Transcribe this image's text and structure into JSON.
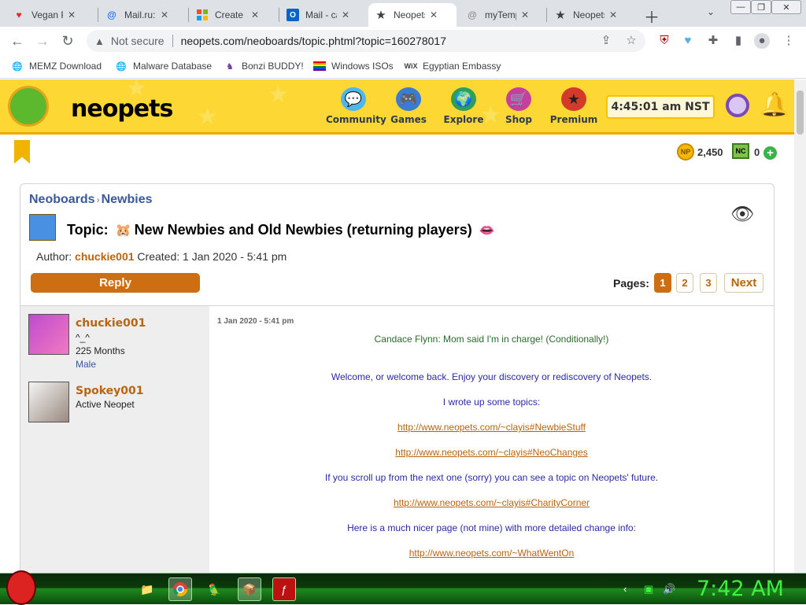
{
  "browser": {
    "tabs": [
      {
        "title": "Vegan Pa",
        "icon": "heart-icon"
      },
      {
        "title": "Mail.ru: n",
        "icon": "at-icon"
      },
      {
        "title": "Create ac",
        "icon": "windows-icon"
      },
      {
        "title": "Mail - cal",
        "icon": "outlook-icon"
      },
      {
        "title": "Neopets",
        "icon": "star-icon",
        "active": true
      },
      {
        "title": "myTemp",
        "icon": "at-icon"
      },
      {
        "title": "Neopets",
        "icon": "star-icon"
      }
    ],
    "address": {
      "security": "Not secure",
      "url": "neopets.com/neoboards/topic.phtml?topic=160278017"
    },
    "bookmarks": [
      {
        "label": "MEMZ Download"
      },
      {
        "label": "Malware Database"
      },
      {
        "label": "Bonzi BUDDY!"
      },
      {
        "label": "Windows ISOs"
      },
      {
        "label": "Egyptian Embassy"
      }
    ]
  },
  "header": {
    "logo": "neopets",
    "nav": [
      {
        "label": "Community"
      },
      {
        "label": "Games"
      },
      {
        "label": "Explore"
      },
      {
        "label": "Shop"
      },
      {
        "label": "Premium"
      }
    ],
    "clock": "4:45:01 am NST"
  },
  "wallet": {
    "neopoints": "2,450",
    "neocash": "0"
  },
  "board": {
    "crumb": {
      "parent": "Neoboards",
      "sep": "›",
      "current": "Newbies"
    },
    "topic_title": "Topic:",
    "topic_name": "New Newbies and Old Newbies (returning players)",
    "author_label": "Author:",
    "author": "chuckie001",
    "created_label": "Created:",
    "created": "1 Jan 2020 - 5:41 pm",
    "reply": "Reply",
    "pages_label": "Pages:",
    "pages": [
      "1",
      "2",
      "3"
    ],
    "next": "Next"
  },
  "post": {
    "author": {
      "name": "chuckie001",
      "tag": "^_^",
      "months": "225 Months",
      "gender": "Male"
    },
    "pet": {
      "name": "Spokey001",
      "status": "Active Neopet"
    },
    "date": "1 Jan 2020 - 5:41 pm",
    "lines": [
      "Candace Flynn: Mom said I'm in charge! (Conditionally!)",
      "Welcome, or welcome back. Enjoy your discovery or rediscovery of Neopets.",
      "I wrote up some topics:",
      "http://www.neopets.com/~clayis#NewbieStuff",
      "http://www.neopets.com/~clayis#NeoChanges",
      "If you scroll up from the next one (sorry) you can see a topic on Neopets' future.",
      "http://www.neopets.com/~clayis#CharityCorner",
      "Here is a much nicer page (not mine) with more detailed change info:",
      "http://www.neopets.com/~WhatWentOn"
    ]
  },
  "taskbar": {
    "clock": "7:42 AM"
  }
}
